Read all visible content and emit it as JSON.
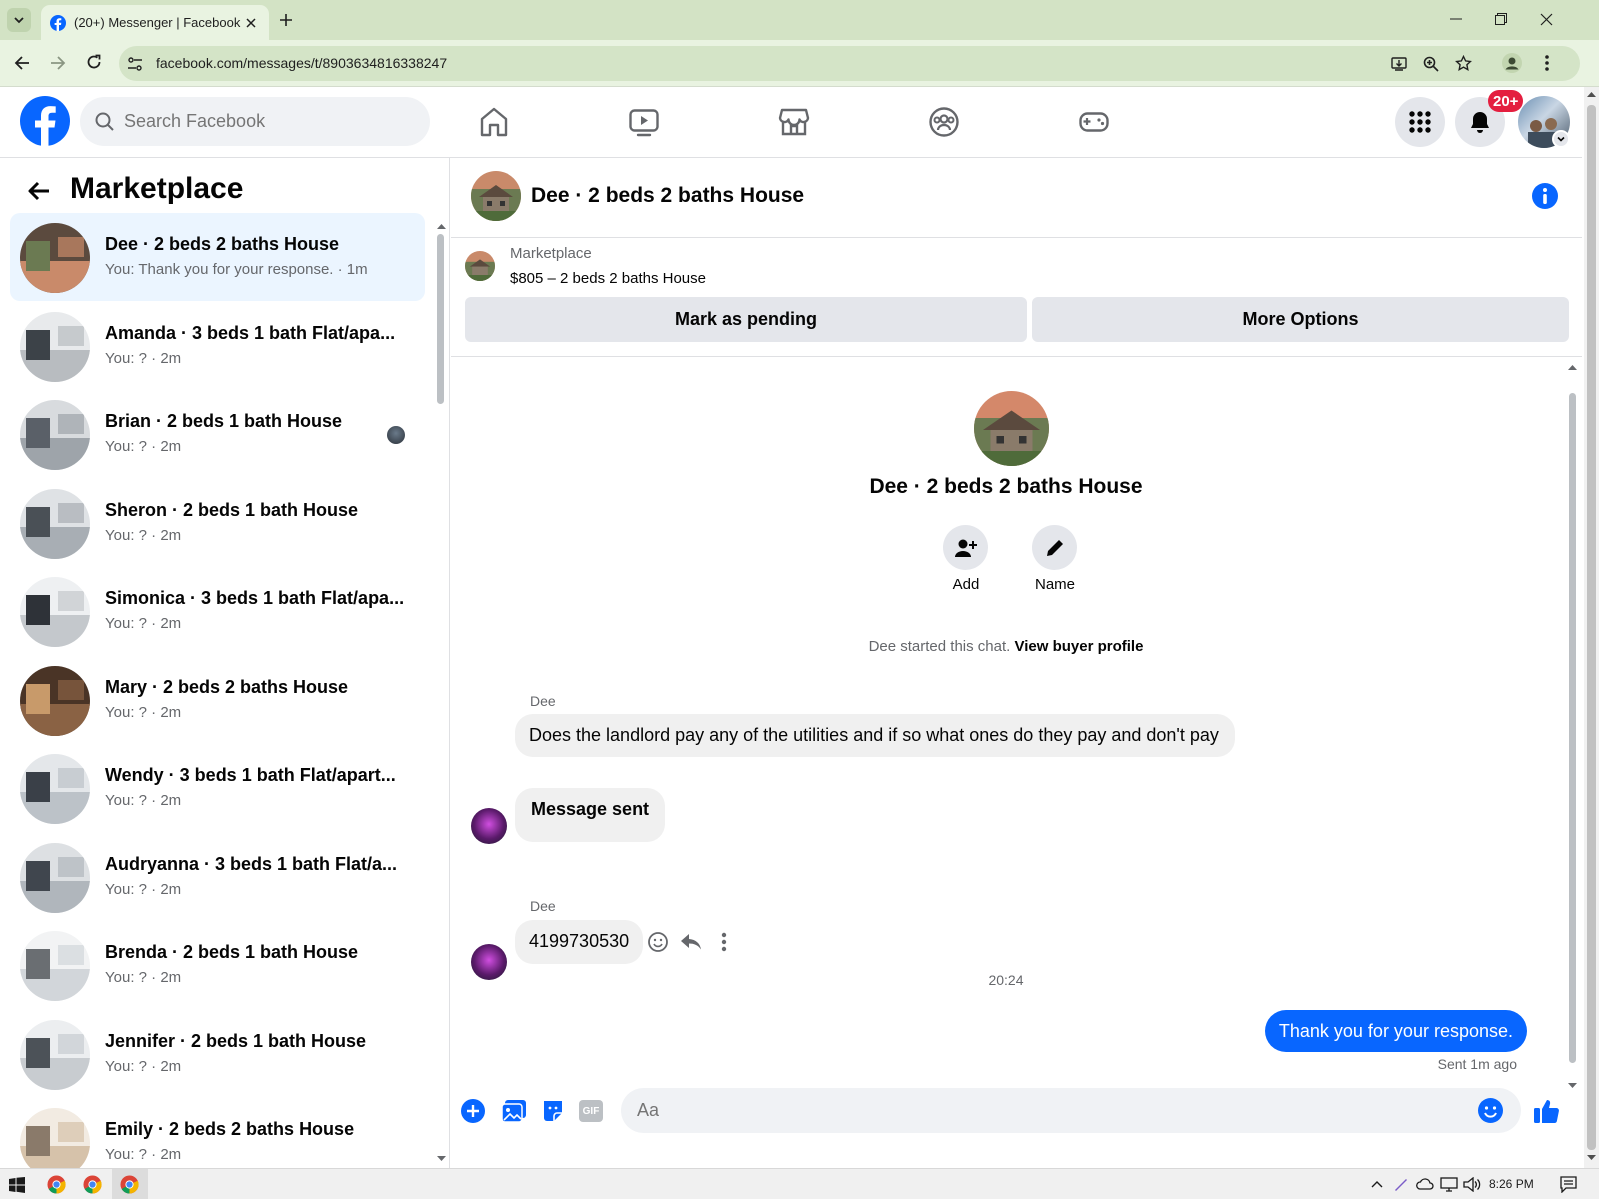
{
  "browser": {
    "tab_title": "(20+) Messenger | Facebook",
    "url": "facebook.com/messages/t/8903634816338247"
  },
  "header": {
    "search_placeholder": "Search Facebook",
    "notification_badge": "20+"
  },
  "sidebar": {
    "title": "Marketplace",
    "conversations": [
      {
        "title": "Dee · 2 beds 2 baths House",
        "subtitle": "You: Thank you for your response. · 1m"
      },
      {
        "title": "Amanda · 3 beds 1 bath Flat/apa...",
        "subtitle": "You: ? · 2m"
      },
      {
        "title": "Brian · 2 beds 1 bath House",
        "subtitle": "You: ? · 2m"
      },
      {
        "title": "Sheron · 2 beds 1 bath House",
        "subtitle": "You: ? · 2m"
      },
      {
        "title": "Simonica · 3 beds 1 bath Flat/apa...",
        "subtitle": "You: ? · 2m"
      },
      {
        "title": "Mary · 2 beds 2 baths House",
        "subtitle": "You: ? · 2m"
      },
      {
        "title": "Wendy · 3 beds 1 bath Flat/apart...",
        "subtitle": "You: ? · 2m"
      },
      {
        "title": "Audryanna · 3 beds 1 bath Flat/a...",
        "subtitle": "You: ? · 2m"
      },
      {
        "title": "Brenda · 2 beds 1 bath House",
        "subtitle": "You: ? · 2m"
      },
      {
        "title": "Jennifer · 2 beds 1 bath House",
        "subtitle": "You: ? · 2m"
      },
      {
        "title": "Emily · 2 beds 2 baths House",
        "subtitle": "You: ? · 2m"
      }
    ]
  },
  "chat": {
    "title": "Dee · 2 beds 2 baths House",
    "listing_label": "Marketplace",
    "listing_price": "$805 – 2 beds 2 baths House",
    "mark_pending": "Mark as pending",
    "more_options": "More Options",
    "profile_name": "Dee · 2 beds 2 baths House",
    "add_label": "Add",
    "name_label": "Name",
    "started_text": "Dee started this chat.",
    "view_buyer": "View buyer profile",
    "sender1": "Dee",
    "message1": "Does the landlord pay any of the utilities and if so what ones do they pay and don't pay",
    "message2": "Message sent",
    "sender2": "Dee",
    "message3": "4199730530",
    "time_divider": "20:24",
    "my_message": "Thank you for your response.",
    "sent_status": "Sent 1m ago",
    "composer_placeholder": "Aa",
    "gif_label": "GIF"
  },
  "taskbar": {
    "clock": "8:26 PM"
  },
  "colors": {
    "fb_blue": "#0866ff",
    "selected_row": "#ebf5ff",
    "badge_red": "#e41e3f",
    "chrome_green": "#d3e3c5"
  }
}
